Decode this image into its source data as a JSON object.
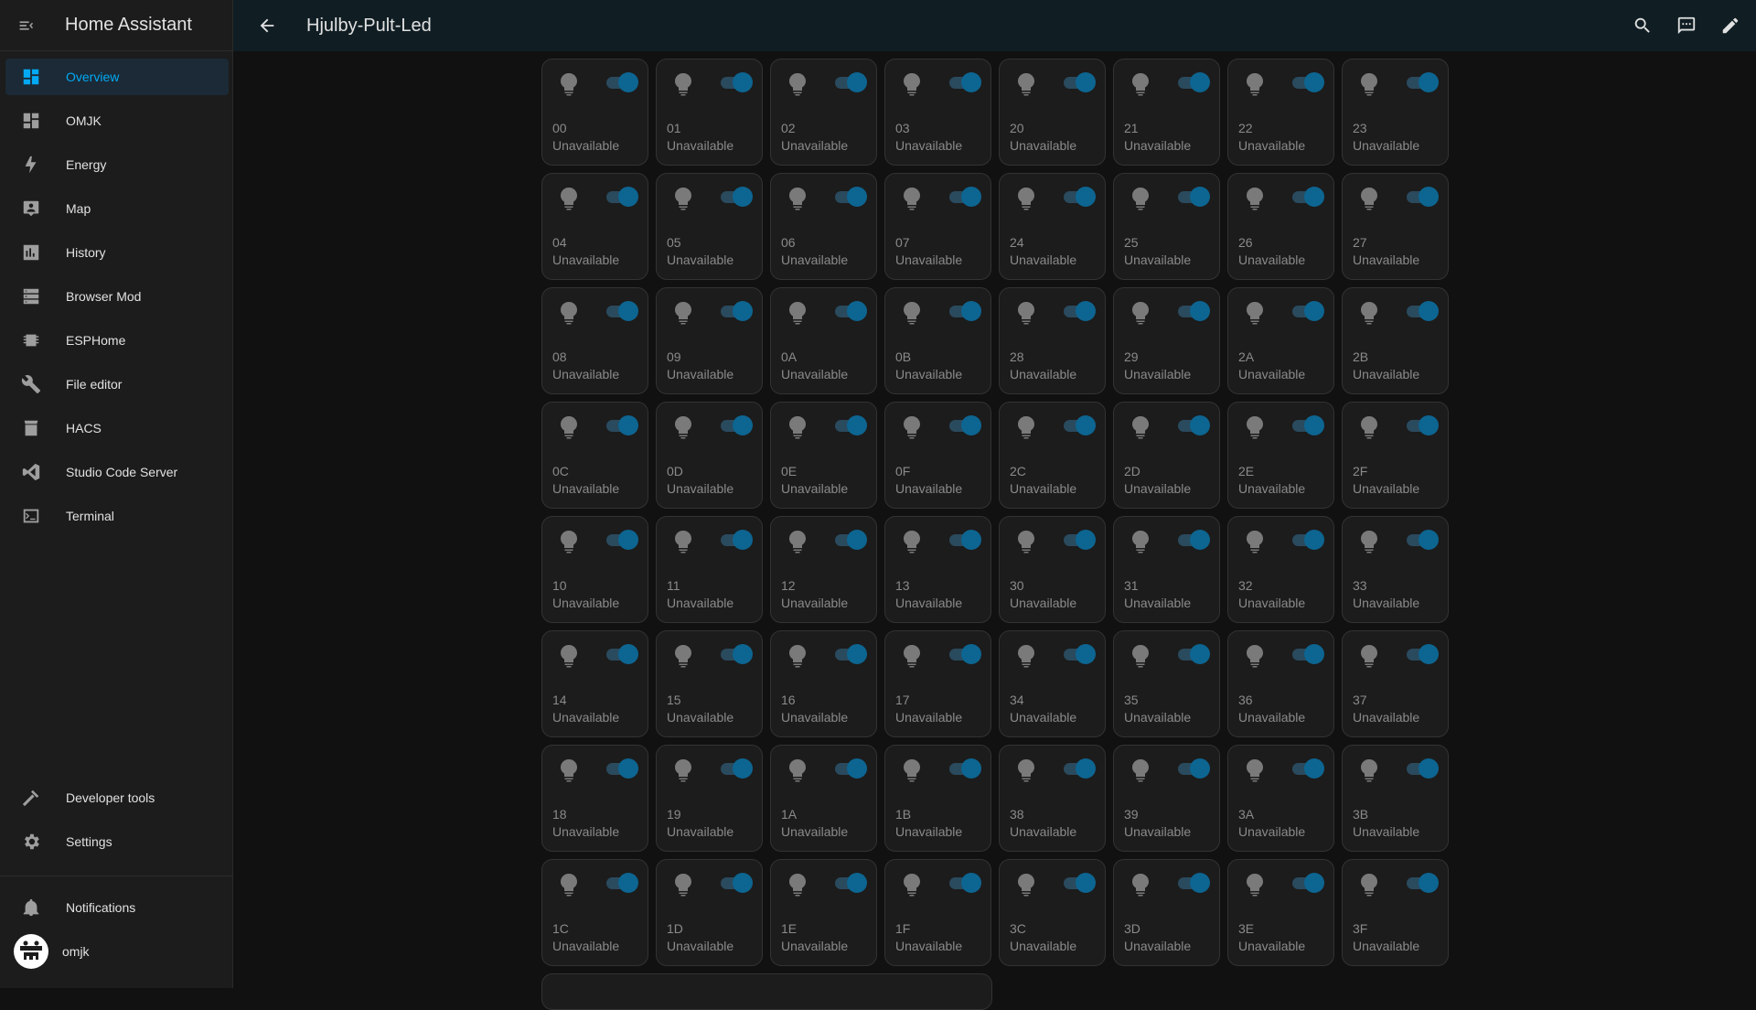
{
  "app": {
    "title": "Home Assistant"
  },
  "page": {
    "title": "Hjulby-Pult-Led"
  },
  "sidebar": {
    "items": [
      {
        "label": "Overview",
        "icon": "dashboard-icon"
      },
      {
        "label": "OMJK",
        "icon": "dashboard-icon"
      },
      {
        "label": "Energy",
        "icon": "lightning-icon"
      },
      {
        "label": "Map",
        "icon": "map-icon"
      },
      {
        "label": "History",
        "icon": "chart-bar-icon"
      },
      {
        "label": "Browser Mod",
        "icon": "server-icon"
      },
      {
        "label": "ESPHome",
        "icon": "chip-icon"
      },
      {
        "label": "File editor",
        "icon": "wrench-icon"
      },
      {
        "label": "HACS",
        "icon": "hacs-icon"
      },
      {
        "label": "Studio Code Server",
        "icon": "vscode-icon"
      },
      {
        "label": "Terminal",
        "icon": "console-icon"
      }
    ],
    "bottom": [
      {
        "label": "Developer tools",
        "icon": "hammer-icon"
      },
      {
        "label": "Settings",
        "icon": "gear-icon"
      }
    ],
    "notifications": {
      "label": "Notifications",
      "icon": "bell-icon"
    },
    "user": {
      "label": "omjk",
      "icon": "avatar"
    }
  },
  "header": {
    "actions": [
      "search-icon",
      "assist-icon",
      "pencil-icon"
    ]
  },
  "tiles": [
    {
      "name": "00",
      "state": "Unavailable"
    },
    {
      "name": "01",
      "state": "Unavailable"
    },
    {
      "name": "02",
      "state": "Unavailable"
    },
    {
      "name": "03",
      "state": "Unavailable"
    },
    {
      "name": "20",
      "state": "Unavailable"
    },
    {
      "name": "21",
      "state": "Unavailable"
    },
    {
      "name": "22",
      "state": "Unavailable"
    },
    {
      "name": "23",
      "state": "Unavailable"
    },
    {
      "name": "04",
      "state": "Unavailable"
    },
    {
      "name": "05",
      "state": "Unavailable"
    },
    {
      "name": "06",
      "state": "Unavailable"
    },
    {
      "name": "07",
      "state": "Unavailable"
    },
    {
      "name": "24",
      "state": "Unavailable"
    },
    {
      "name": "25",
      "state": "Unavailable"
    },
    {
      "name": "26",
      "state": "Unavailable"
    },
    {
      "name": "27",
      "state": "Unavailable"
    },
    {
      "name": "08",
      "state": "Unavailable"
    },
    {
      "name": "09",
      "state": "Unavailable"
    },
    {
      "name": "0A",
      "state": "Unavailable"
    },
    {
      "name": "0B",
      "state": "Unavailable"
    },
    {
      "name": "28",
      "state": "Unavailable"
    },
    {
      "name": "29",
      "state": "Unavailable"
    },
    {
      "name": "2A",
      "state": "Unavailable"
    },
    {
      "name": "2B",
      "state": "Unavailable"
    },
    {
      "name": "0C",
      "state": "Unavailable"
    },
    {
      "name": "0D",
      "state": "Unavailable"
    },
    {
      "name": "0E",
      "state": "Unavailable"
    },
    {
      "name": "0F",
      "state": "Unavailable"
    },
    {
      "name": "2C",
      "state": "Unavailable"
    },
    {
      "name": "2D",
      "state": "Unavailable"
    },
    {
      "name": "2E",
      "state": "Unavailable"
    },
    {
      "name": "2F",
      "state": "Unavailable"
    },
    {
      "name": "10",
      "state": "Unavailable"
    },
    {
      "name": "11",
      "state": "Unavailable"
    },
    {
      "name": "12",
      "state": "Unavailable"
    },
    {
      "name": "13",
      "state": "Unavailable"
    },
    {
      "name": "30",
      "state": "Unavailable"
    },
    {
      "name": "31",
      "state": "Unavailable"
    },
    {
      "name": "32",
      "state": "Unavailable"
    },
    {
      "name": "33",
      "state": "Unavailable"
    },
    {
      "name": "14",
      "state": "Unavailable"
    },
    {
      "name": "15",
      "state": "Unavailable"
    },
    {
      "name": "16",
      "state": "Unavailable"
    },
    {
      "name": "17",
      "state": "Unavailable"
    },
    {
      "name": "34",
      "state": "Unavailable"
    },
    {
      "name": "35",
      "state": "Unavailable"
    },
    {
      "name": "36",
      "state": "Unavailable"
    },
    {
      "name": "37",
      "state": "Unavailable"
    },
    {
      "name": "18",
      "state": "Unavailable"
    },
    {
      "name": "19",
      "state": "Unavailable"
    },
    {
      "name": "1A",
      "state": "Unavailable"
    },
    {
      "name": "1B",
      "state": "Unavailable"
    },
    {
      "name": "38",
      "state": "Unavailable"
    },
    {
      "name": "39",
      "state": "Unavailable"
    },
    {
      "name": "3A",
      "state": "Unavailable"
    },
    {
      "name": "3B",
      "state": "Unavailable"
    },
    {
      "name": "1C",
      "state": "Unavailable"
    },
    {
      "name": "1D",
      "state": "Unavailable"
    },
    {
      "name": "1E",
      "state": "Unavailable"
    },
    {
      "name": "1F",
      "state": "Unavailable"
    },
    {
      "name": "3C",
      "state": "Unavailable"
    },
    {
      "name": "3D",
      "state": "Unavailable"
    },
    {
      "name": "3E",
      "state": "Unavailable"
    },
    {
      "name": "3F",
      "state": "Unavailable"
    }
  ],
  "colors": {
    "accent": "#03a9f4",
    "header_bg": "#101e24",
    "sidebar_bg": "#1c1c1c",
    "toggle_on": "#0d6591"
  }
}
